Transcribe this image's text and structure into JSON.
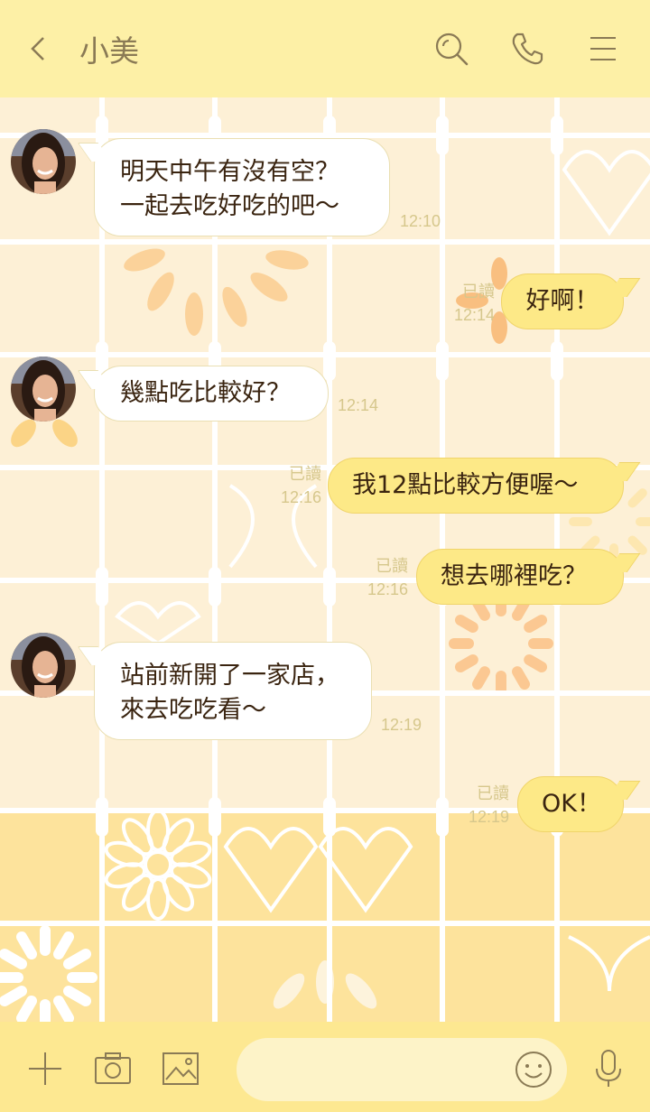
{
  "header": {
    "title": "小美",
    "icons": [
      "back-chevron-icon",
      "search-icon",
      "phone-icon",
      "menu-icon"
    ]
  },
  "theme": {
    "header_bg": "#fdf0a6",
    "footer_bg": "#fde891",
    "incoming_bubble": "#ffffff",
    "outgoing_bubble": "#fde987",
    "text_color": "#3a2410",
    "meta_color": "#d6c78c"
  },
  "messages": [
    {
      "direction": "in",
      "lines": [
        "明天中午有沒有空？",
        "一起去吃好吃的吧～"
      ],
      "time": "12:10"
    },
    {
      "direction": "out",
      "text": "好啊！",
      "read": "已讀",
      "time": "12:14"
    },
    {
      "direction": "in",
      "lines": [
        "幾點吃比較好？"
      ],
      "time": "12:14"
    },
    {
      "direction": "out",
      "text": "我12點比較方便喔～",
      "read": "已讀",
      "time": "12:16"
    },
    {
      "direction": "out",
      "text": "想去哪裡吃？",
      "read": "已讀",
      "time": "12:16"
    },
    {
      "direction": "in",
      "lines": [
        "站前新開了一家店，",
        "來去吃吃看～"
      ],
      "time": "12:19"
    },
    {
      "direction": "out",
      "text": "OK！",
      "read": "已讀",
      "time": "12:19"
    }
  ],
  "footer": {
    "input_placeholder": "",
    "icons": [
      "plus-icon",
      "camera-icon",
      "image-icon",
      "emoji-icon",
      "microphone-icon"
    ]
  }
}
